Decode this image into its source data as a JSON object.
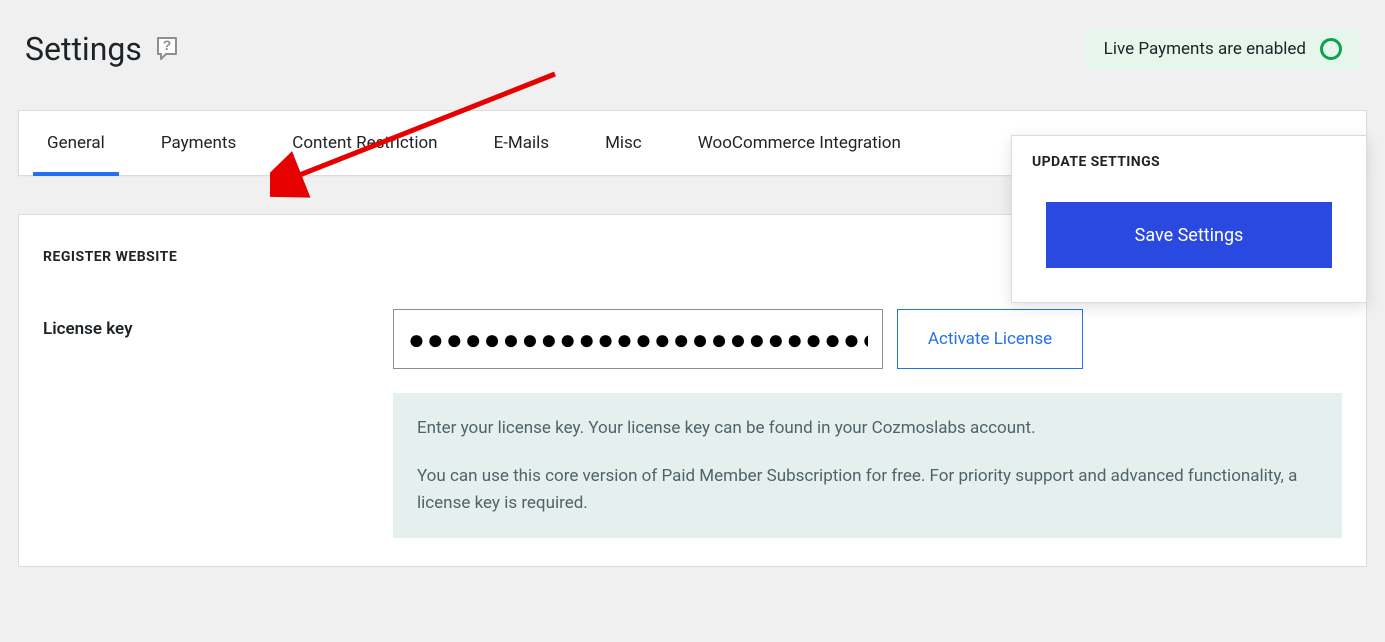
{
  "page": {
    "title": "Settings"
  },
  "status": {
    "label": "Live Payments are enabled"
  },
  "tabs": {
    "general": "General",
    "payments": "Payments",
    "content_restriction": "Content Restriction",
    "emails": "E-Mails",
    "misc": "Misc",
    "woocommerce": "WooCommerce Integration"
  },
  "section": {
    "heading": "REGISTER WEBSITE"
  },
  "license": {
    "label": "License key",
    "masked_value": "●●●●●●●●●●●●●●●●●●●●●●●●●●●●●●●●",
    "activate_label": "Activate License",
    "help_line1": "Enter your license key. Your license key can be found in your Cozmoslabs account.",
    "help_line2": "You can use this core version of Paid Member Subscription for free. For priority support and advanced functionality, a license key is required."
  },
  "update_panel": {
    "heading": "UPDATE SETTINGS",
    "save_label": "Save Settings"
  }
}
